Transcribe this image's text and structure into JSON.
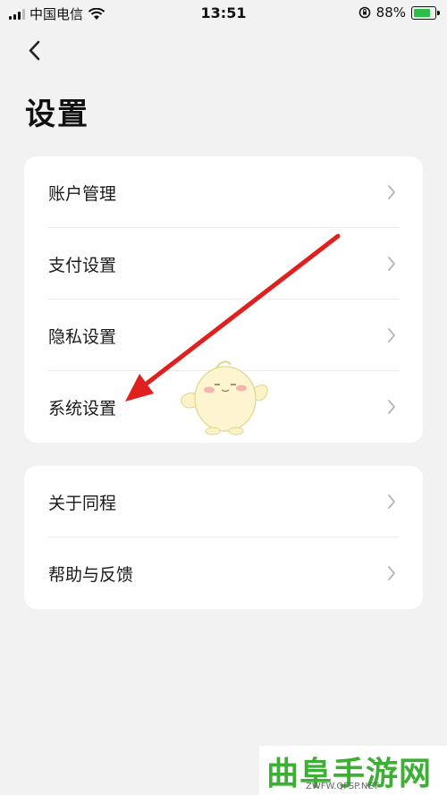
{
  "status_bar": {
    "carrier": "中国电信",
    "time": "13:51",
    "battery": "88%",
    "battery_level": 0.88,
    "icons": [
      "signal-icon",
      "wifi-icon",
      "rotation-lock-icon",
      "battery-icon"
    ]
  },
  "header": {
    "back_icon": "chevron-left-icon",
    "title": "设置"
  },
  "group1": {
    "items": [
      {
        "label": "账户管理"
      },
      {
        "label": "支付设置"
      },
      {
        "label": "隐私设置"
      },
      {
        "label": "系统设置"
      }
    ]
  },
  "group2": {
    "items": [
      {
        "label": "关于同程"
      },
      {
        "label": "帮助与反馈"
      }
    ]
  },
  "annotation": {
    "arrow_color": "#e0201e",
    "target": "系统设置"
  },
  "watermark": {
    "text": "曲阜手游网",
    "url": "ZWFW.QFSP.NET",
    "color": "#3cb034"
  }
}
